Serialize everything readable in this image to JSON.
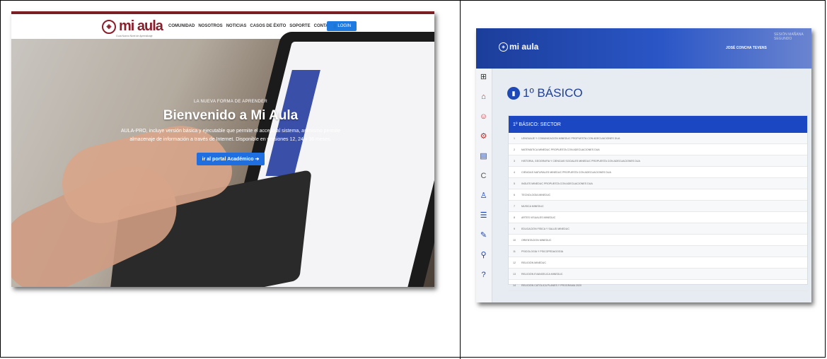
{
  "left": {
    "logo": {
      "text": "mi aula",
      "subtitle": "Guía Nuevo Nivel de Aprendizaje"
    },
    "nav": [
      "COMUNIDAD",
      "NOSOTROS",
      "NOTICIAS",
      "CASOS DE ÉXITO",
      "SOPORTE",
      "CONTACTO"
    ],
    "login_label": "LOGIN",
    "hero": {
      "kicker": "LA NUEVA FORMA DE APRENDER",
      "title": "Bienvenido a Mi Aula",
      "description": "AULA-PRO, incluye versión básica y ejecutable que permite el acceso al sistema, asimismo permite almacenaje de información a través de Internet. Disponible en versiones 12, 24 y 36 meses.",
      "cta": "ir al portal Académico"
    }
  },
  "right": {
    "logo": {
      "text": "mi aula"
    },
    "user_name": "JOSÉ CONCHA TEVENS",
    "corner_text": "SESIÓN MAÑANA SEGUNDO",
    "page_title": "1º BÁSICO",
    "table_header": "1º BÁSICO: SECTOR",
    "rows": [
      {
        "num": "1",
        "name": "LENGUAJE Y COMUNICACIÓN MINEDUC PROPUESTA CON ADECUACIONES DUA"
      },
      {
        "num": "2",
        "name": "MATEMÁTICA MINEDUC PROPUESTA CON ADECUACIONES DUA"
      },
      {
        "num": "3",
        "name": "HISTORIA, GEOGRAFÍA Y CIENCIAS SOCIALES MINEDUC PROPUESTA CON ADECUACIONES DUA"
      },
      {
        "num": "4",
        "name": "CIENCIAS NATURALES MINEDUC PROPUESTA CON ADECUACIONES DUA"
      },
      {
        "num": "5",
        "name": "INGLÉS MINEDUC PROPUESTA CON ADECUACIONES DUA"
      },
      {
        "num": "6",
        "name": "TECNOLOGÍA MINEDUC"
      },
      {
        "num": "7",
        "name": "MÚSICA MINEDUC"
      },
      {
        "num": "8",
        "name": "ARTES VISUALES MINEDUC"
      },
      {
        "num": "9",
        "name": "EDUCACIÓN FÍSICA Y SALUD MINEDUC"
      },
      {
        "num": "10",
        "name": "ORIENTACIÓN MINEDUC"
      },
      {
        "num": "11",
        "name": "PSICOLOGÍA Y PSICOPEDAGOGÍA"
      },
      {
        "num": "12",
        "name": "RELIGIÓN MINEDUC"
      },
      {
        "num": "13",
        "name": "RELIGIÓN EVANGÉLICA MINEDUC"
      },
      {
        "num": "14",
        "name": "RELIGIÓN CATÓLICA PLANES Y PROGRAMA 2020"
      }
    ],
    "sidebar_icons": [
      "network-icon",
      "school-icon",
      "users-icon",
      "settings-icon",
      "document-icon",
      "refresh-icon",
      "person-icon",
      "notes-icon",
      "edit-icon",
      "search-icon",
      "help-icon"
    ]
  }
}
